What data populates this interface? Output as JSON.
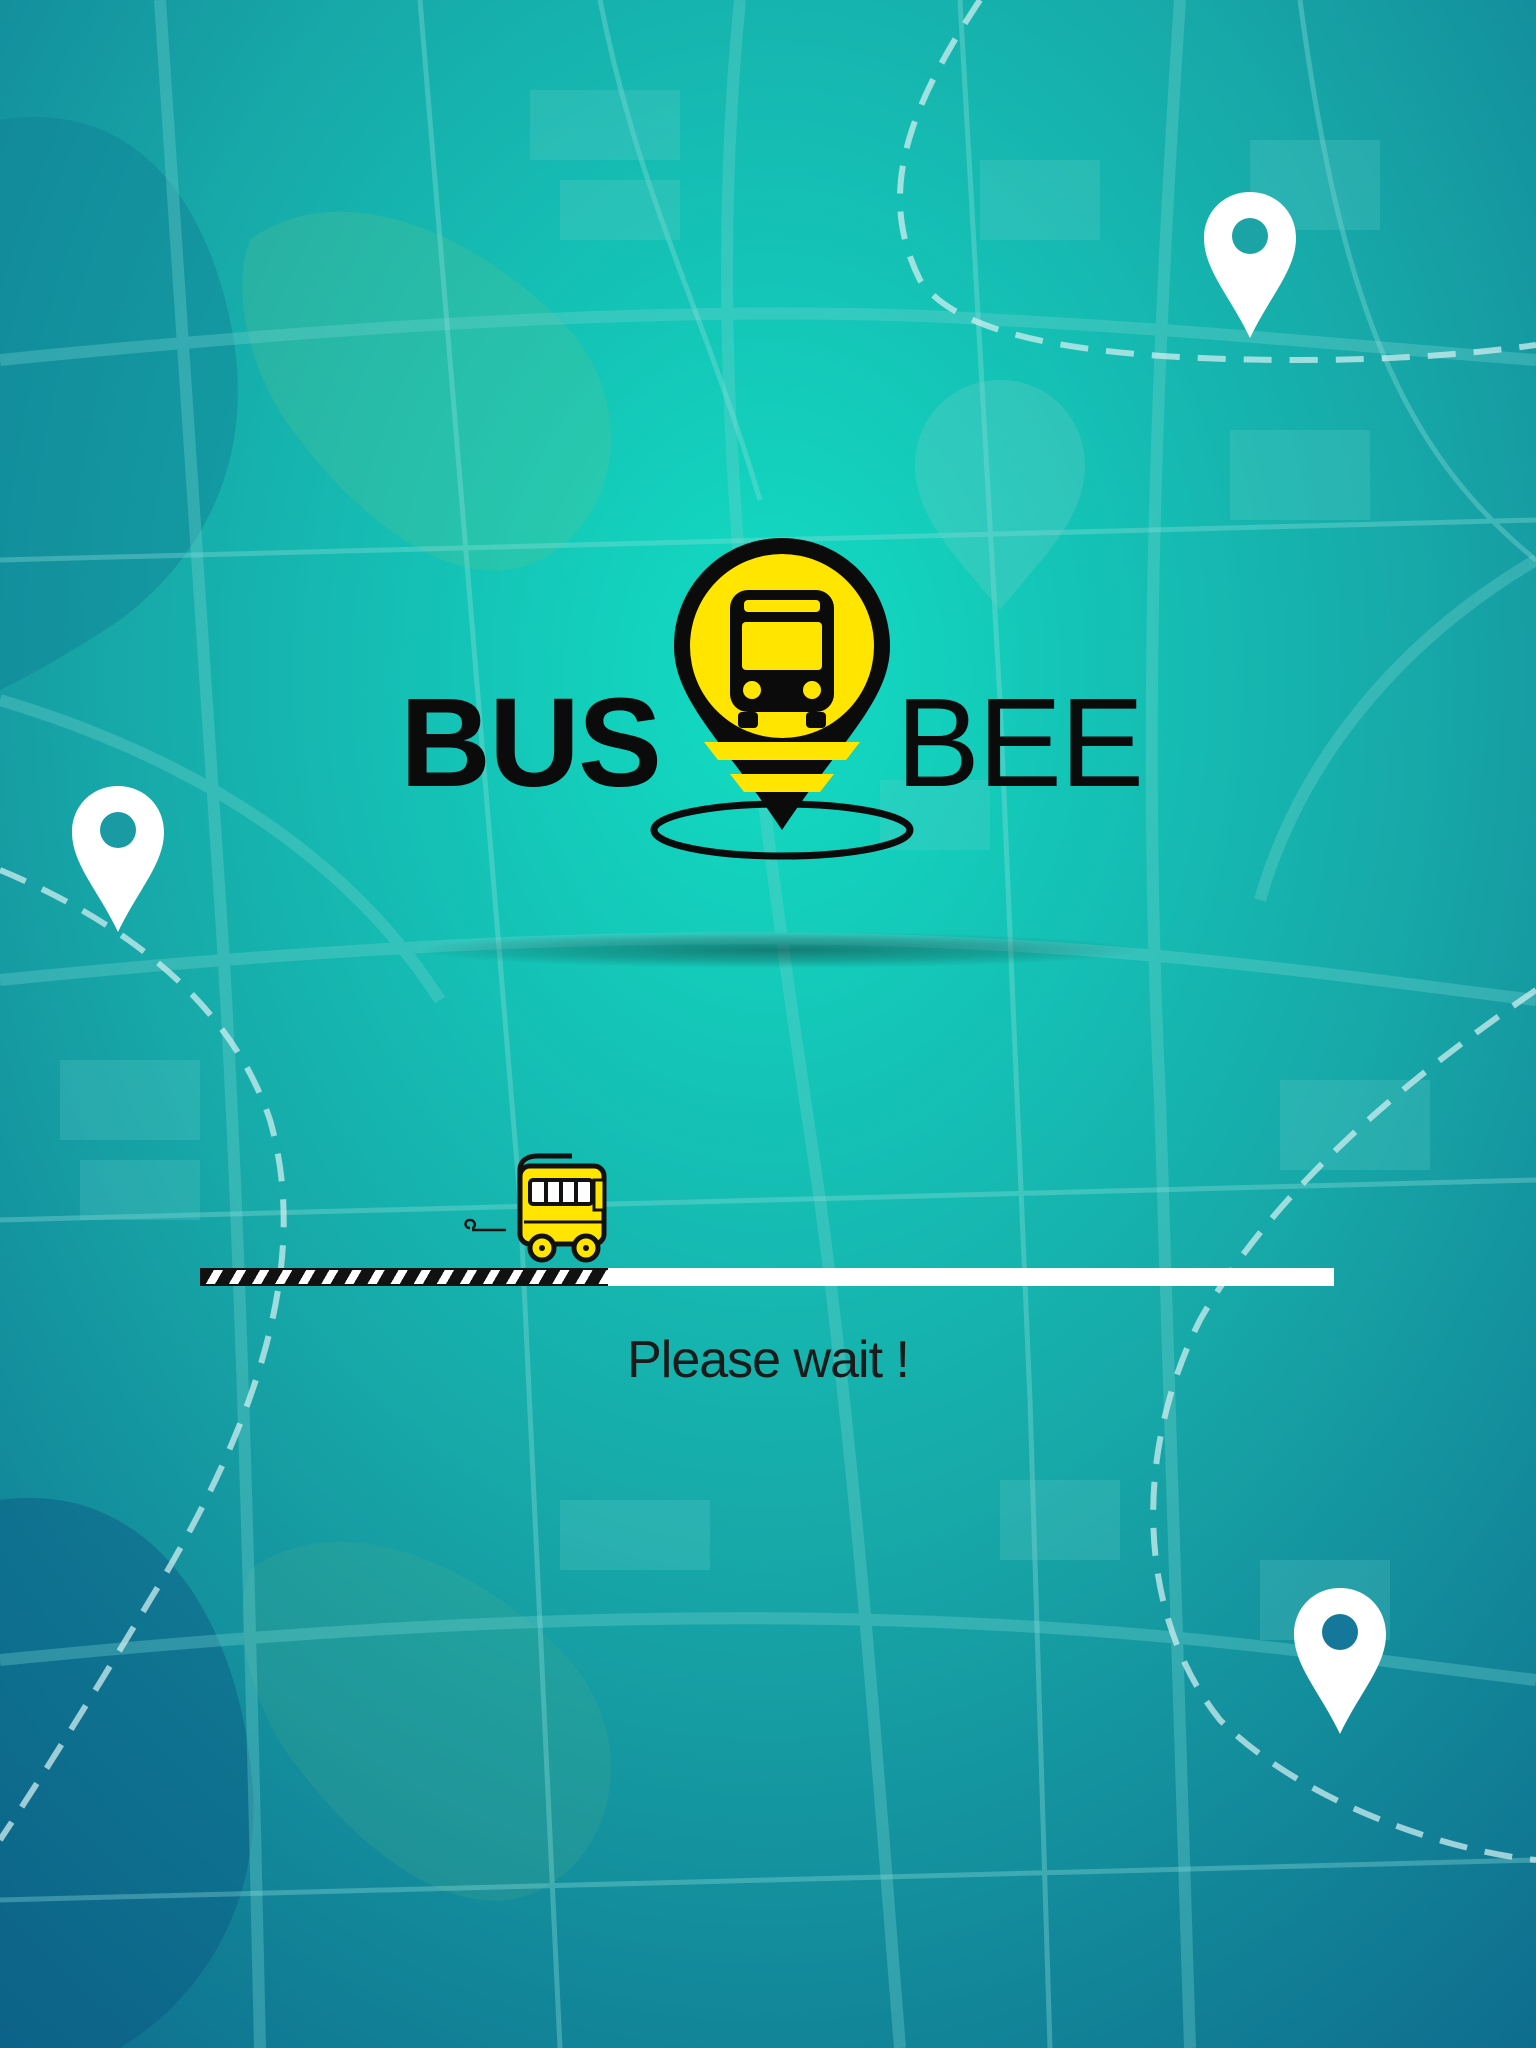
{
  "app": {
    "name_part1": "BUS",
    "name_part2": "BEE",
    "logo_icon": "bus-location-pin-icon"
  },
  "loading": {
    "status_text": "Please wait !",
    "progress": 0.36,
    "indicator_icon": "school-bus-icon"
  },
  "background": {
    "type": "city-map",
    "decorative_icons": [
      "location-pin-icon",
      "location-pin-icon",
      "location-pin-icon"
    ]
  },
  "colors": {
    "background_light": "#12d6bd",
    "background_dark": "#0b5a86",
    "accent_yellow": "#ffe500",
    "text_dark": "#0b0b0b",
    "track": "#ffffff"
  }
}
